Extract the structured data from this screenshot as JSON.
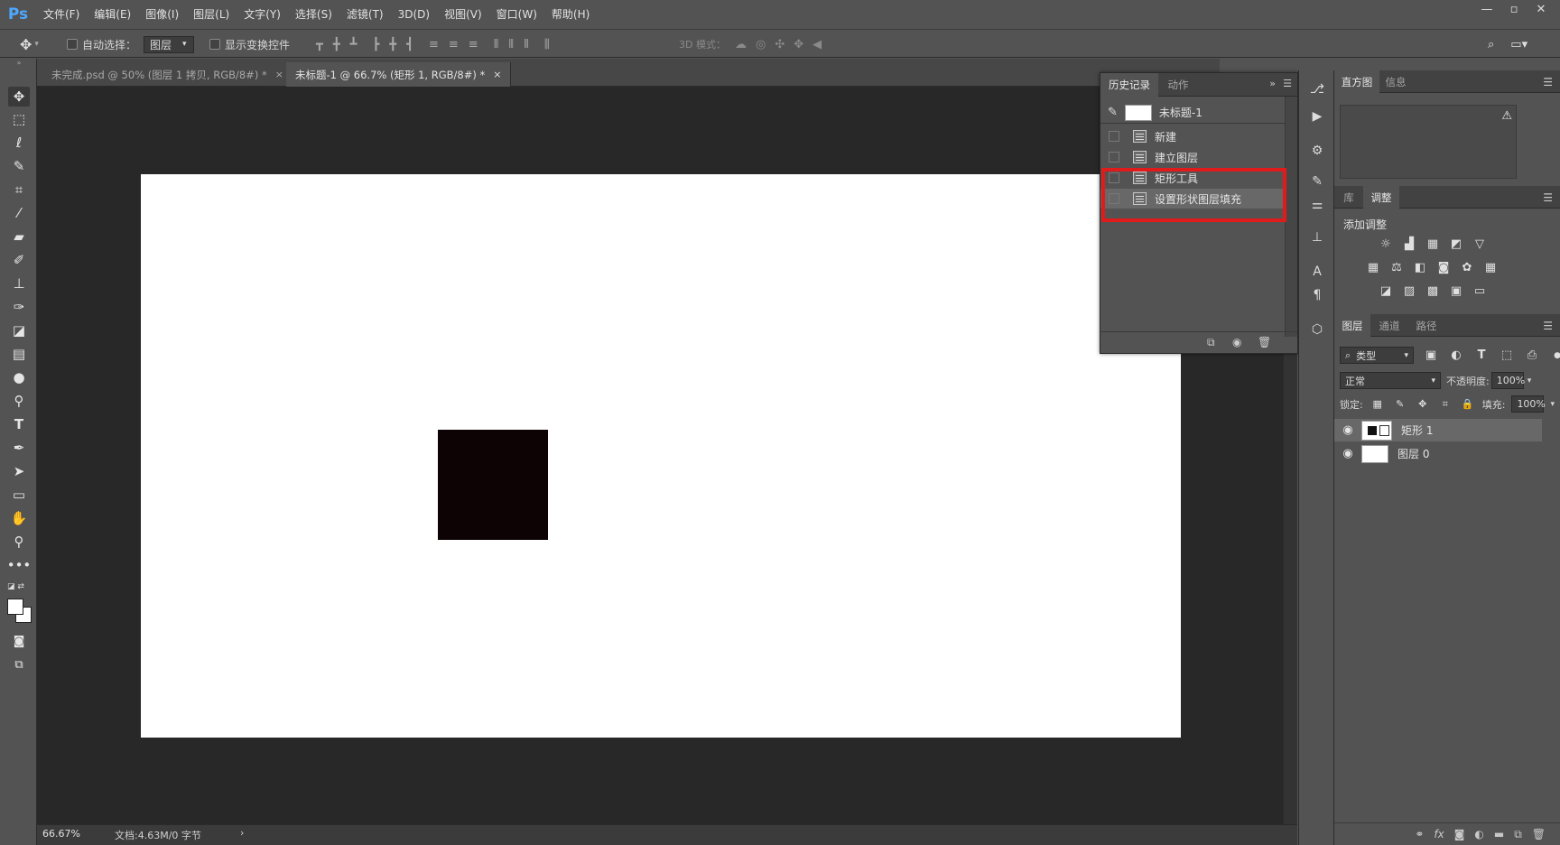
{
  "app": {
    "logo": "Ps"
  },
  "menubar": {
    "items": [
      "文件(F)",
      "编辑(E)",
      "图像(I)",
      "图层(L)",
      "文字(Y)",
      "选择(S)",
      "滤镜(T)",
      "3D(D)",
      "视图(V)",
      "窗口(W)",
      "帮助(H)"
    ],
    "window_controls": [
      "—",
      "▫",
      "✕"
    ]
  },
  "options_bar": {
    "auto_select_label": "自动选择：",
    "auto_select_value": "图层",
    "show_transform_label": "显示变换控件",
    "mode_3d_label": "3D 模式："
  },
  "tabs": [
    {
      "label": "未完成.psd @ 50% (图层 1 拷贝, RGB/8#) *",
      "close": "×"
    },
    {
      "label": "未标题-1 @ 66.7% (矩形 1, RGB/8#) *",
      "close": "×"
    }
  ],
  "status": {
    "zoom": "66.67%",
    "doc_info": "文档:4.63M/0 字节",
    "arrow": "›"
  },
  "history_panel": {
    "tabs": [
      "历史记录",
      "动作"
    ],
    "snapshot_label": "未标题-1",
    "items": [
      "新建",
      "建立图层",
      "矩形工具",
      "设置形状图层填充"
    ],
    "selected_index": 3,
    "highlight_color": "#e01b1b"
  },
  "right_panels": {
    "histogram_tabs": [
      "直方图",
      "信息"
    ],
    "adjust_tabs": [
      "库",
      "调整"
    ],
    "adjust_title": "添加调整",
    "layers_tabs": [
      "图层",
      "通道",
      "路径"
    ],
    "filter_kind": "类型",
    "blend_mode": "正常",
    "opacity_label": "不透明度:",
    "opacity_value": "100%",
    "lock_label": "锁定:",
    "fill_label": "填充:",
    "fill_value": "100%",
    "layers": [
      {
        "name": "矩形 1",
        "selected": true
      },
      {
        "name": "图层 0",
        "selected": false
      }
    ]
  },
  "colors": {
    "canvas_bg": "#282828",
    "document": "#ffffff",
    "shape_fill": "#0d0204",
    "accent_logo": "#4ea8ff"
  }
}
